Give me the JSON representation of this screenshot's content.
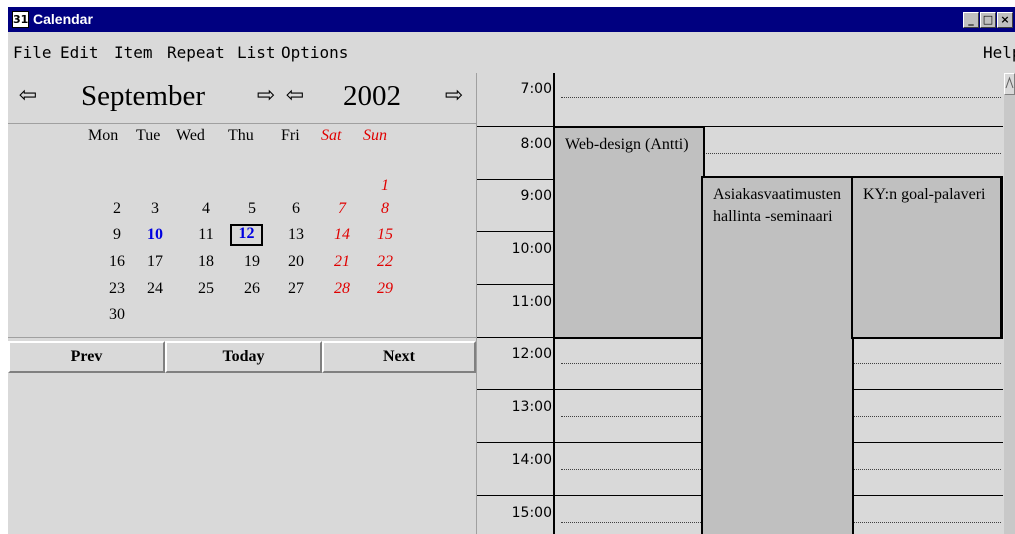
{
  "window": {
    "title": "Calendar"
  },
  "titlebar_buttons": {
    "minimize": "_",
    "maximize": "□",
    "close": "×"
  },
  "menu": {
    "items": [
      "File",
      "Edit",
      "Item",
      "Repeat",
      "List",
      "Options"
    ],
    "help": "Help"
  },
  "month_nav": {
    "prev_icon": "⇦",
    "month": "September",
    "next_icon": "⇨",
    "year": "2002"
  },
  "weekdays": [
    "Mon",
    "Tue",
    "Wed",
    "Thu",
    "Fri",
    "Sat",
    "Sun"
  ],
  "calendar": {
    "weeks": [
      [
        "",
        "",
        "",
        "",
        "",
        "",
        "1"
      ],
      [
        "2",
        "3",
        "4",
        "5",
        "6",
        "7",
        "8"
      ],
      [
        "9",
        "10",
        "11",
        "12",
        "13",
        "14",
        "15"
      ],
      [
        "16",
        "17",
        "18",
        "19",
        "20",
        "21",
        "22"
      ],
      [
        "23",
        "24",
        "25",
        "26",
        "27",
        "28",
        "29"
      ],
      [
        "30",
        "",
        "",
        "",
        "",
        "",
        ""
      ]
    ],
    "highlighted_day": "10",
    "selected_day": "12"
  },
  "buttons": {
    "prev": "Prev",
    "today": "Today",
    "next": "Next"
  },
  "schedule": {
    "hours": [
      "7:00",
      "8:00",
      "9:00",
      "10:00",
      "11:00",
      "12:00",
      "13:00",
      "14:00",
      "15:00"
    ],
    "events": [
      {
        "title": "Web-design (Antti)"
      },
      {
        "title": "Asiakasvaatimusten hallinta -seminaari"
      },
      {
        "title": "KY:n goal-palaveri"
      }
    ]
  },
  "colors": {
    "titlebar": "#000080",
    "weekend": "#e00000",
    "today": "#0000e0",
    "window_bg": "#d9d9d9",
    "event_bg": "#c0c0c0"
  },
  "icons": {
    "window": "calendar-app-icon",
    "prev_month": "left-arrow-icon",
    "next_month": "right-arrow-icon",
    "prev_year": "left-arrow-icon",
    "next_year": "right-arrow-icon"
  }
}
